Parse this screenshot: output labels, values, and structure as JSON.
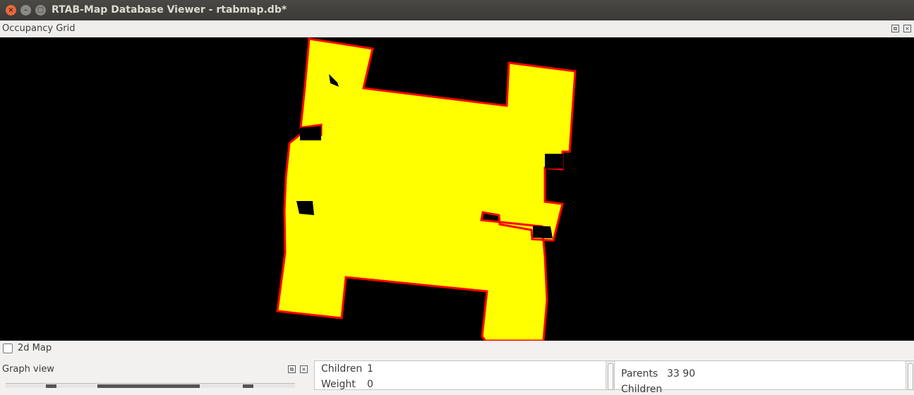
{
  "window": {
    "title": "RTAB-Map Database Viewer - rtabmap.db*",
    "close_glyph": "×",
    "minimize_glyph": "–",
    "maximize_glyph": "▢"
  },
  "occupancy_dock": {
    "title": "Occupancy Grid",
    "float_glyph": "⧉",
    "close_glyph": "×"
  },
  "map_colors": {
    "background": "#000000",
    "free": "#ffff00",
    "obstacle": "#ff0000"
  },
  "options": {
    "map_2d_label": "2d Map",
    "map_2d_checked": false
  },
  "graph_dock": {
    "title": "Graph view",
    "float_glyph": "⧉",
    "close_glyph": "×"
  },
  "info_left": {
    "children_label": "Children",
    "children_value": "1",
    "weight_label": "Weight",
    "weight_value": "0"
  },
  "info_right": {
    "parents_label": "Parents",
    "parents_value": "33 90",
    "next_label": "Children"
  }
}
